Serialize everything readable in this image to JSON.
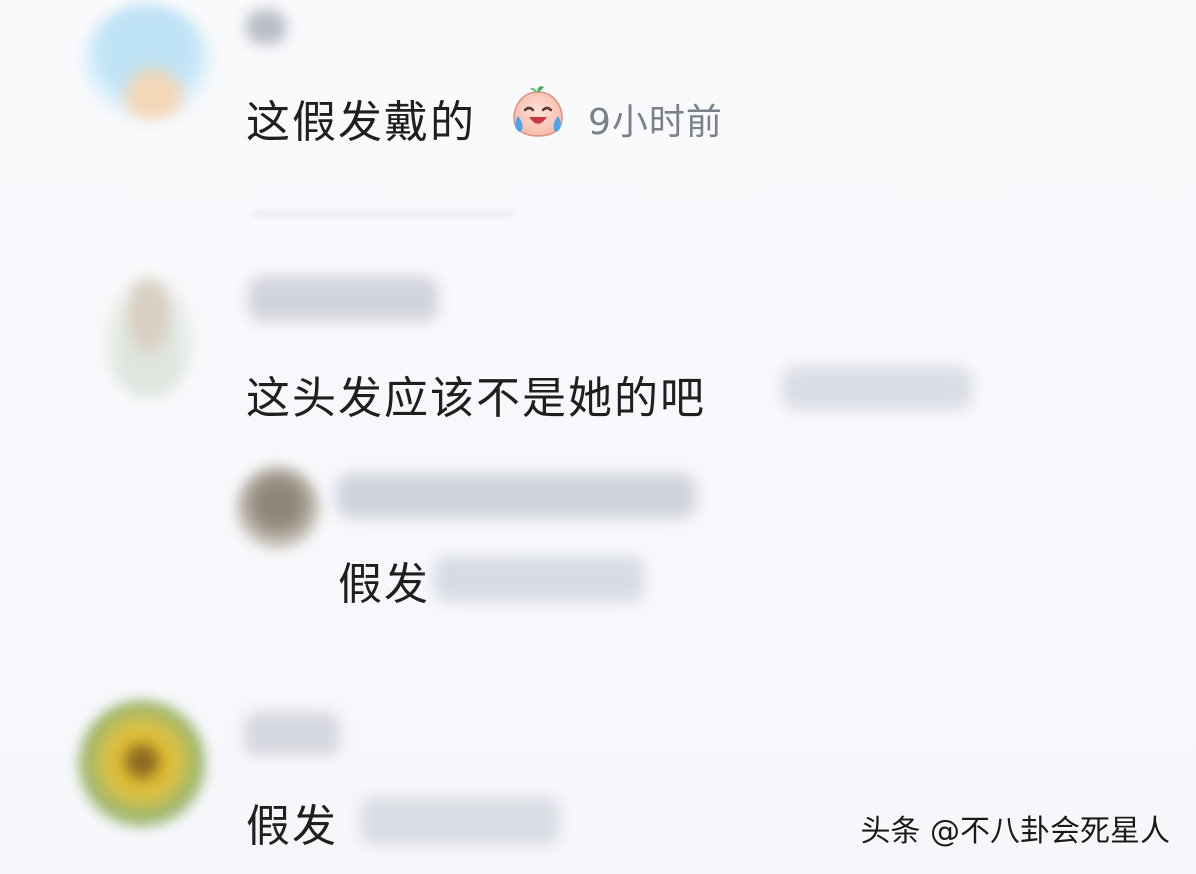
{
  "comments": [
    {
      "text": "这假发戴的",
      "emoji_icon": "laughing-crying-face-icon",
      "timestamp": "9小时前"
    },
    {
      "text": "这头发应该不是她的吧"
    },
    {
      "text": "假发",
      "is_reply": true
    },
    {
      "text": "假发"
    }
  ],
  "watermark": "头条 @不八卦会死星人",
  "colors": {
    "background": "#f7f8fb",
    "timestamp": "#7c808b",
    "text": "#1f1f1f"
  }
}
